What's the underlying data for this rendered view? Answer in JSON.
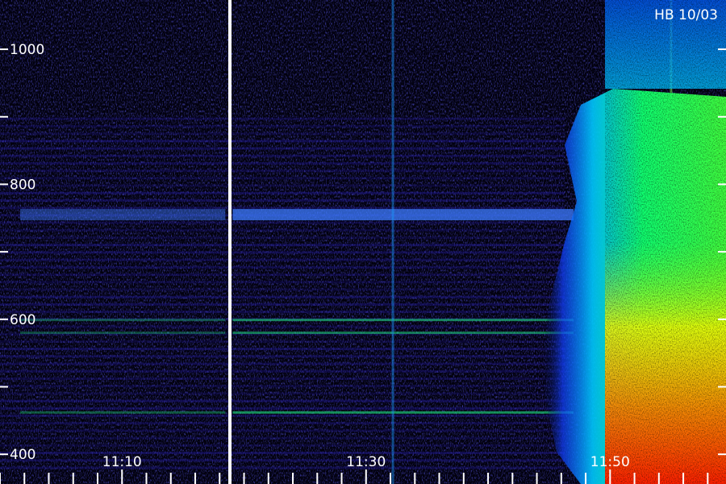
{
  "header": {
    "station_label": "HB 10/03"
  },
  "chart_data": {
    "type": "heatmap",
    "title": "",
    "xlabel": "",
    "ylabel": "",
    "x_tick_labels": [
      "11:10",
      "11:30",
      "11:50"
    ],
    "y_tick_labels": [
      "400",
      "600",
      "800",
      "1000"
    ],
    "x_label_times_min": [
      70,
      90,
      110
    ],
    "x_minor_tick_interval_min": 2,
    "xlim_min": [
      60,
      119.5
    ],
    "ylim": [
      356,
      1073
    ],
    "y_tick_interval": 100,
    "y_label_interval": 200,
    "data_gap_after_time_min": 78.8,
    "dominant_bands": [
      {
        "frequency": 755,
        "relative_intensity": 0.75
      },
      {
        "frequency": 599,
        "relative_intensity": 0.55
      },
      {
        "frequency": 580,
        "relative_intensity": 0.5
      },
      {
        "frequency": 462,
        "relative_intensity": 0.6
      }
    ],
    "activity_regions": [
      {
        "type": "broadband_onset",
        "start_time_min": 106,
        "frequency_range": [
          356,
          900
        ],
        "peak_intensity": "high"
      },
      {
        "type": "strong_emission",
        "start_time_min": 110,
        "frequency_range": [
          356,
          500
        ],
        "peak_intensity": "max"
      }
    ],
    "colormap": [
      "#000010",
      "#1a0a80",
      "#2040ff",
      "#00c8ff",
      "#00ff60",
      "#ffff00",
      "#ff8000",
      "#ff2000"
    ]
  }
}
